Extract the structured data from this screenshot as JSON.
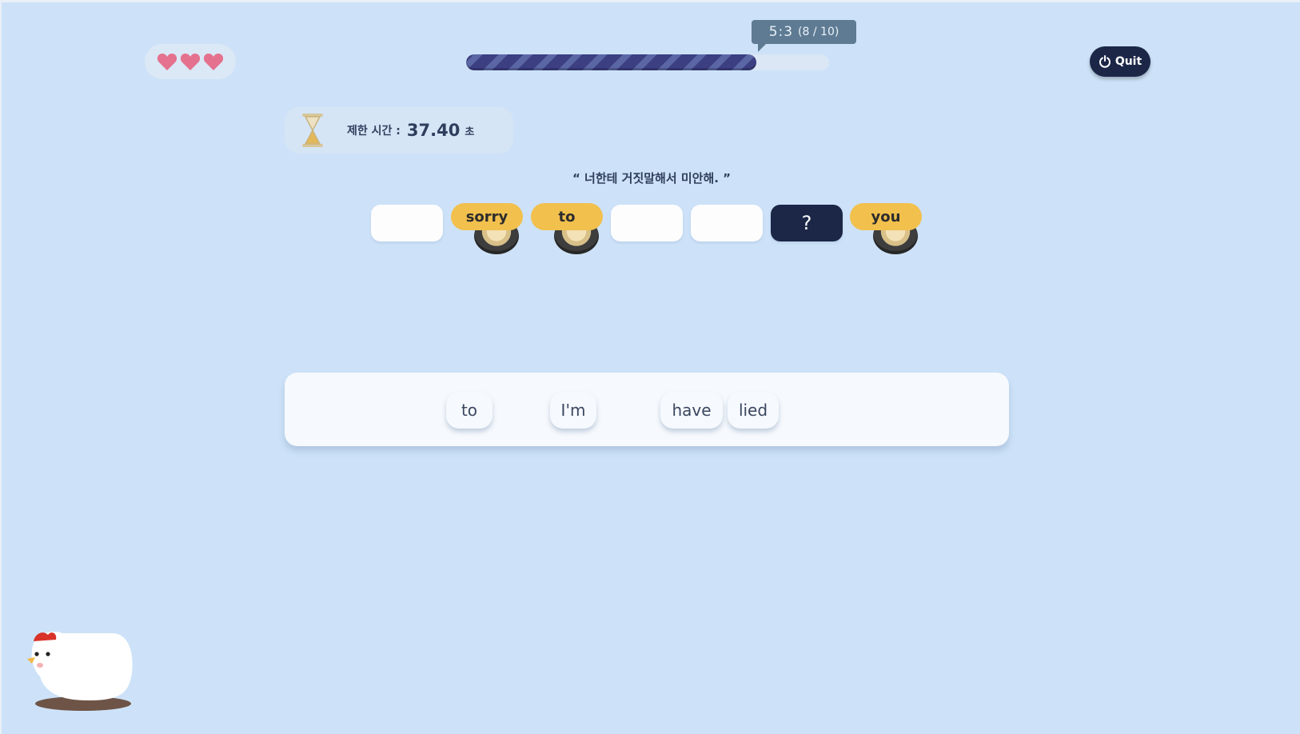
{
  "lives": {
    "count": 3,
    "color": "#e4718e"
  },
  "progress": {
    "fraction": 0.8,
    "score_main": "5:3",
    "score_sub": "(8 / 10)"
  },
  "quit": {
    "label": "Quit"
  },
  "timer": {
    "label": "제한 시간 :",
    "value": "37.40",
    "unit": "초"
  },
  "prompt": {
    "text": "“ 너한테 거짓말해서 미안해. ”"
  },
  "slots": [
    {
      "text": ""
    },
    {
      "text": "sorry"
    },
    {
      "text": "to"
    },
    {
      "text": ""
    },
    {
      "text": ""
    },
    {
      "text": "?"
    },
    {
      "text": "you"
    }
  ],
  "word_bank": [
    "to",
    "I'm",
    "have",
    "lied"
  ],
  "colors": {
    "background": "#cde2f8",
    "chip": "#f2c04d",
    "dark": "#1c2748",
    "progress": "#3c3f82"
  }
}
